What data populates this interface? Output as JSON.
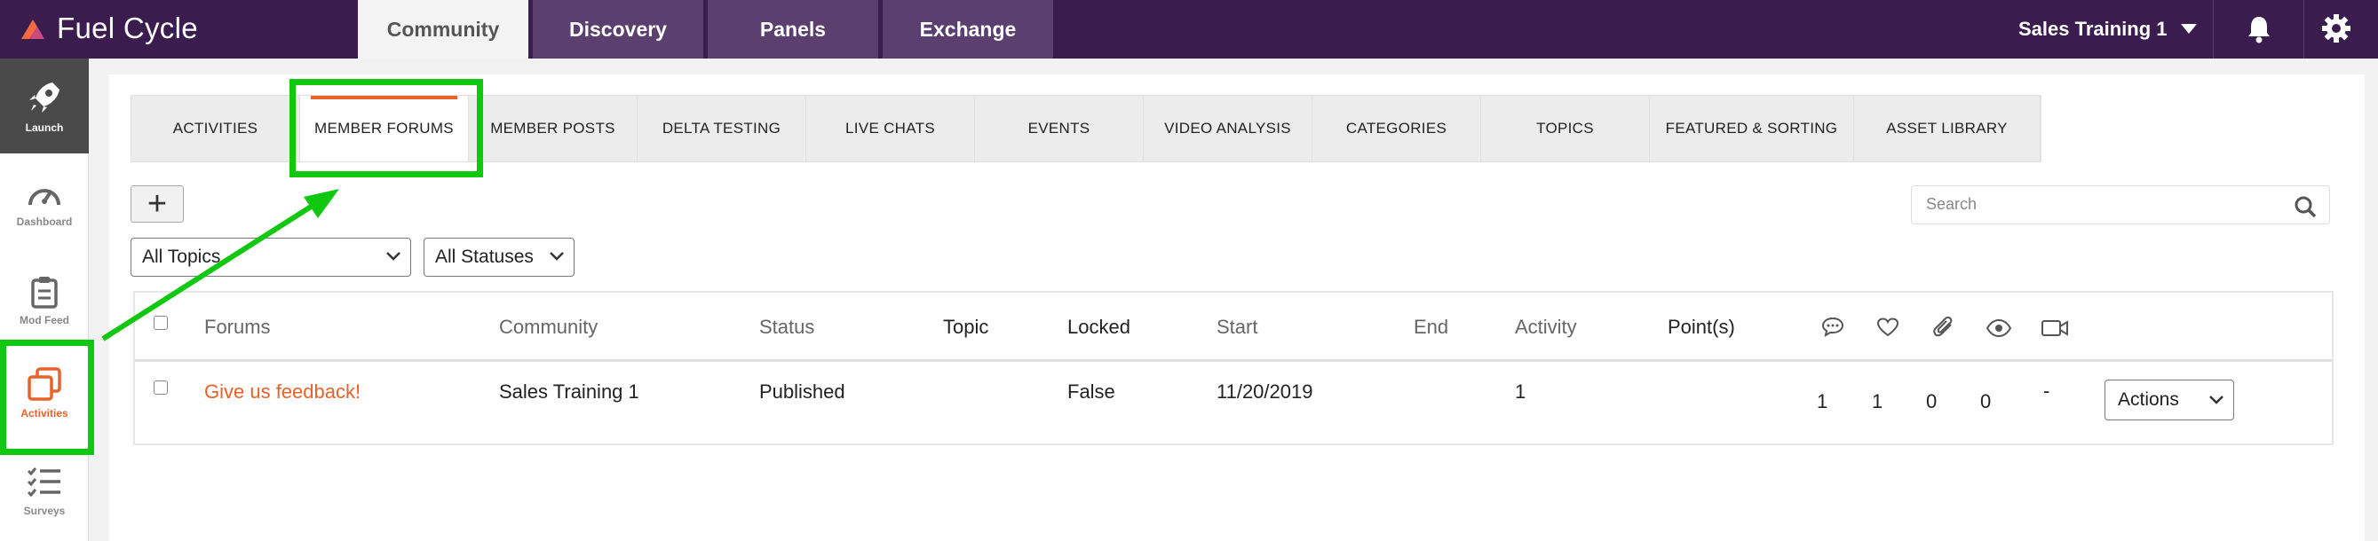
{
  "brand": {
    "name": "Fuel Cycle",
    "accent": "#e8622a",
    "nav_bg": "#3a1c4f"
  },
  "main_tabs": [
    {
      "label": "Community",
      "active": true
    },
    {
      "label": "Discovery",
      "active": false
    },
    {
      "label": "Panels",
      "active": false
    },
    {
      "label": "Exchange",
      "active": false
    }
  ],
  "account": {
    "name": "Sales Training 1"
  },
  "sidebar": {
    "items": [
      {
        "label": "Launch",
        "icon": "rocket-icon",
        "active": true
      },
      {
        "label": "Dashboard",
        "icon": "gauge-icon"
      },
      {
        "label": "Mod Feed",
        "icon": "clipboard-icon"
      },
      {
        "label": "Activities",
        "icon": "stack-icon",
        "highlighted": true
      },
      {
        "label": "Surveys",
        "icon": "checklist-icon"
      }
    ]
  },
  "sub_tabs": [
    {
      "label": "ACTIVITIES"
    },
    {
      "label": "MEMBER FORUMS",
      "active": true
    },
    {
      "label": "MEMBER POSTS"
    },
    {
      "label": "DELTA TESTING"
    },
    {
      "label": "LIVE CHATS"
    },
    {
      "label": "EVENTS"
    },
    {
      "label": "VIDEO ANALYSIS"
    },
    {
      "label": "CATEGORIES"
    },
    {
      "label": "TOPICS"
    },
    {
      "label": "FEATURED & SORTING"
    },
    {
      "label": "ASSET LIBRARY"
    }
  ],
  "toolbar": {
    "add_label": "+"
  },
  "search": {
    "placeholder": "Search"
  },
  "filters": {
    "topics": "All Topics",
    "statuses": "All Statuses"
  },
  "table": {
    "headers": {
      "forums": "Forums",
      "community": "Community",
      "status": "Status",
      "topic": "Topic",
      "locked": "Locked",
      "start": "Start",
      "end": "End",
      "activity": "Activity",
      "points": "Point(s)"
    },
    "header_icons": [
      "comment-icon",
      "heart-icon",
      "paperclip-icon",
      "eye-icon",
      "video-icon"
    ],
    "rows": [
      {
        "forum": "Give us feedback!",
        "community": "Sales Training 1",
        "status": "Published",
        "topic": "",
        "locked": "False",
        "start": "11/20/2019",
        "end": "",
        "activity": "1",
        "points": "",
        "comments": "1",
        "likes": "1",
        "attachments": "0",
        "views": "0",
        "video": "-",
        "actions": "Actions"
      }
    ]
  },
  "annotation_color": "#10c80f"
}
